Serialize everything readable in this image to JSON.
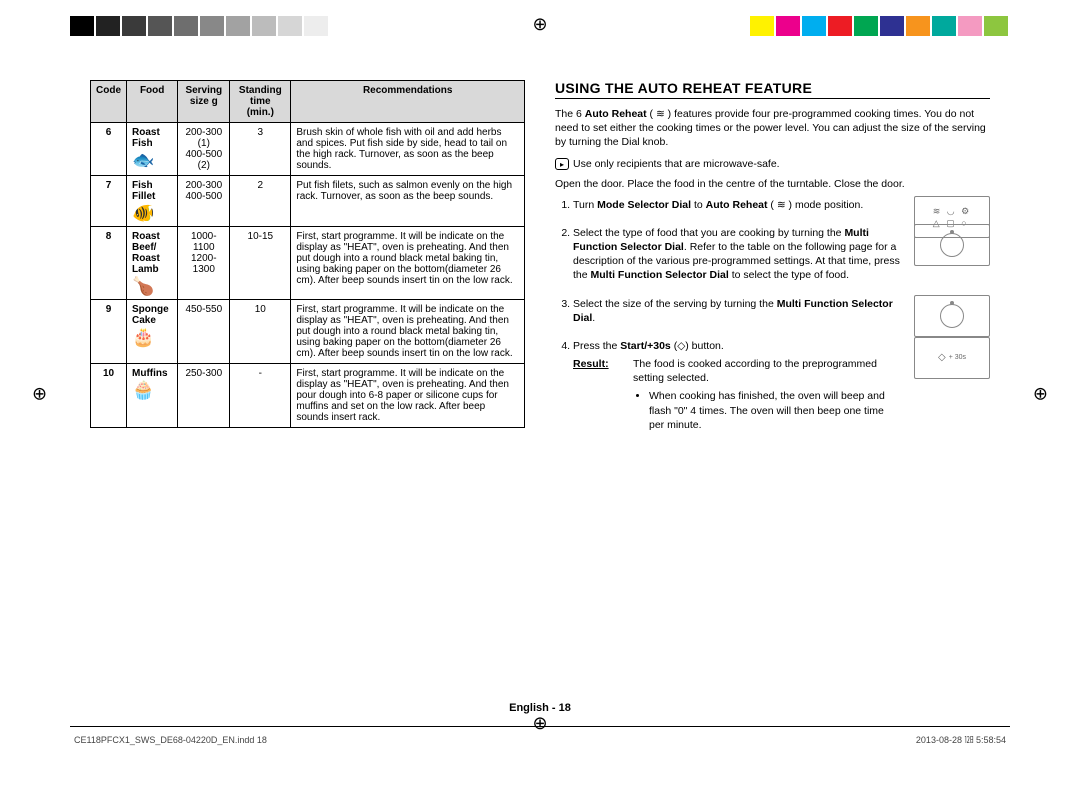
{
  "swatches_left": [
    "#000",
    "#222",
    "#3a3a3a",
    "#555",
    "#6e6e6e",
    "#888",
    "#a2a2a2",
    "#bcbcbc",
    "#d6d6d6",
    "#ededed"
  ],
  "swatches_right": [
    "#fff200",
    "#ec008c",
    "#00aeef",
    "#ed1c24",
    "#00a651",
    "#2e3192",
    "#f7941d",
    "#00a99d",
    "#f49ac1",
    "#8dc63f"
  ],
  "table": {
    "headers": [
      "Code",
      "Food",
      "Serving size g",
      "Standing time (min.)",
      "Recommendations"
    ],
    "rows": [
      {
        "code": "6",
        "food": "Roast Fish",
        "icon": "🐟",
        "serving": "200-300 (1)\n400-500 (2)",
        "stand": "3",
        "rec": "Brush skin of whole fish with oil and add herbs and spices. Put fish side by side, head to tail on the high rack. Turnover, as soon as the beep sounds."
      },
      {
        "code": "7",
        "food": "Fish Fillet",
        "icon": "🐠",
        "serving": "200-300\n400-500",
        "stand": "2",
        "rec": "Put fish filets, such as salmon evenly on the high rack. Turnover, as soon as the beep sounds."
      },
      {
        "code": "8",
        "food": "Roast Beef/\nRoast Lamb",
        "icon": "🍗",
        "serving": "1000-1100\n1200-1300",
        "stand": "10-15",
        "rec": "First, start programme. It will be indicate on the display as \"HEAT\", oven is preheating. And then put dough into a round black metal baking tin, using baking paper on the bottom(diameter 26 cm). After beep sounds insert tin on the low rack."
      },
      {
        "code": "9",
        "food": "Sponge Cake",
        "icon": "🎂",
        "serving": "450-550",
        "stand": "10",
        "rec": "First, start programme. It will be indicate on the display as \"HEAT\", oven is preheating. And then put dough into a round black metal baking tin, using baking paper on the bottom(diameter 26 cm). After beep sounds insert tin on the low rack."
      },
      {
        "code": "10",
        "food": "Muffins",
        "icon": "🧁",
        "serving": "250-300",
        "stand": "-",
        "rec": "First, start programme. It will be indicate on the display as \"HEAT\", oven is preheating. And then pour dough into 6-8 paper or silicone cups for muffins and set on the low rack. After beep sounds insert rack."
      }
    ]
  },
  "section_title": "USING THE AUTO REHEAT FEATURE",
  "intro_text": "The 6 Auto Reheat ( ≋ ) features provide four pre-programmed cooking times. You do not need to set either the cooking times or the power level. You can adjust the size of the serving by turning the Dial knob.",
  "tip_text": "Use only recipients that are microwave-safe.",
  "open_text": "Open the door. Place the food in the centre of the turntable. Close the door.",
  "steps": [
    {
      "html": "Turn <b>Mode Selector Dial</b> to <b>Auto Reheat</b> ( ≋ ) mode position.",
      "fig": "mode-dial"
    },
    {
      "html": "Select the type of food that you are cooking by turning the <b>Multi Function Selector Dial</b>. Refer to the table on the following page for a description of the various pre-programmed settings. At that time, press the <b>Multi Function Selector Dial</b> to select the type of food.",
      "fig": "dial"
    },
    {
      "html": "Select the size of the serving by turning the <b>Multi Function Selector Dial</b>.",
      "fig": "dial"
    },
    {
      "html": "Press the <b>Start/+30s</b> (◇) button.",
      "fig": "start"
    }
  ],
  "result_label": "Result:",
  "result_main": "The food is cooked according to the preprogrammed setting selected.",
  "result_bullet": "When cooking has finished, the oven will beep and flash \"0\" 4 times. The oven will then beep one time per minute.",
  "page_number": "English - 18",
  "footer_left": "CE118PFCX1_SWS_DE68-04220D_EN.indd   18",
  "footer_right": "2013-08-28   ㏫ 5:58:54",
  "start_label": "+ 30s"
}
